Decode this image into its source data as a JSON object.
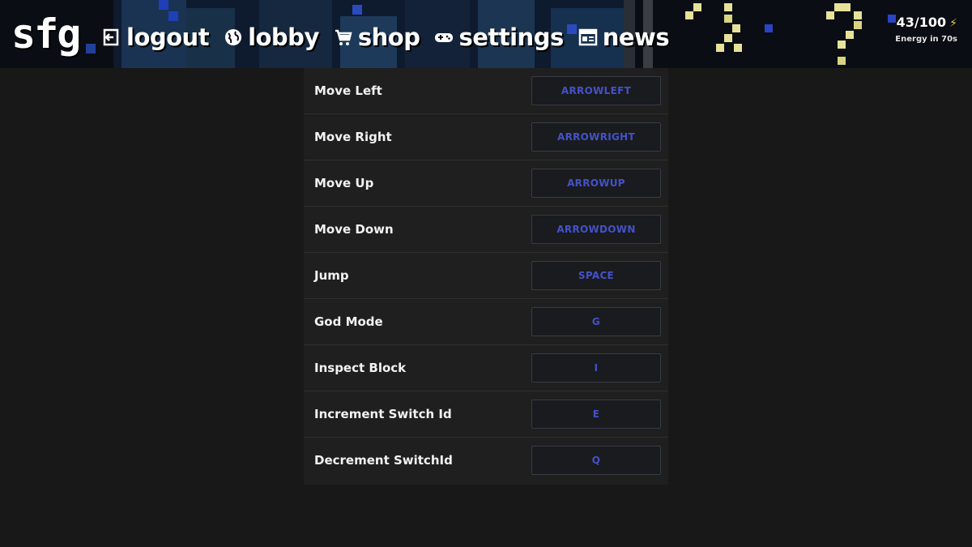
{
  "header": {
    "logo": "sfg",
    "nav": [
      {
        "label": "logout",
        "icon": "logout-icon"
      },
      {
        "label": "lobby",
        "icon": "globe-icon"
      },
      {
        "label": "shop",
        "icon": "cart-icon"
      },
      {
        "label": "settings",
        "icon": "gamepad-icon"
      },
      {
        "label": "news",
        "icon": "newspaper-icon"
      }
    ],
    "energy": {
      "count": "43/100",
      "icon": "lightning-icon",
      "subtitle": "Energy in 70s"
    }
  },
  "keybinds": {
    "rows": [
      {
        "action": "Move Left",
        "key": "ARROWLEFT"
      },
      {
        "action": "Move Right",
        "key": "ARROWRIGHT"
      },
      {
        "action": "Move Up",
        "key": "ARROWUP"
      },
      {
        "action": "Move Down",
        "key": "ARROWDOWN"
      },
      {
        "action": "Jump",
        "key": "SPACE"
      },
      {
        "action": "God Mode",
        "key": "G"
      },
      {
        "action": "Inspect Block",
        "key": "I"
      },
      {
        "action": "Increment Switch Id",
        "key": "E"
      },
      {
        "action": "Decrement SwitchId",
        "key": "Q"
      }
    ]
  },
  "colors": {
    "background": "#181818",
    "panel": "#1f1f1f",
    "key_text": "#4452c8",
    "energy_bolt": "#e8c63a"
  }
}
